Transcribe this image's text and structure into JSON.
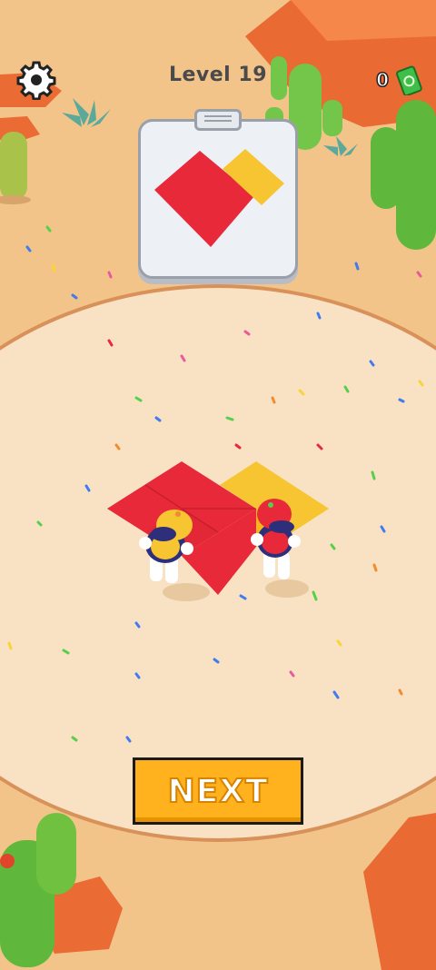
{
  "hud": {
    "level_label": "Level 19",
    "cash_count": "0",
    "settings_icon": "gear-icon",
    "cash_icon": "cash-icon"
  },
  "target_card": {
    "shapes": [
      "red-diamond",
      "yellow-diamond"
    ]
  },
  "next_button": {
    "label": "NEXT"
  },
  "colors": {
    "sand_outer": "#f2c489",
    "arena": "#f9e2c4",
    "red": "#e8293a",
    "yellow": "#f7c531",
    "button": "#ffb21e",
    "cactus": "#6fc13f",
    "rock": "#f07a3a"
  }
}
